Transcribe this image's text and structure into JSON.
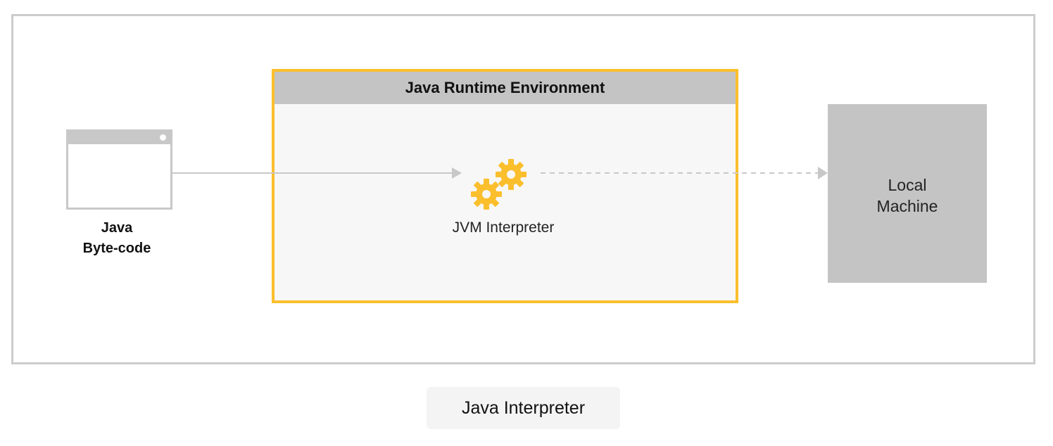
{
  "diagram": {
    "bytecode_label_line1": "Java",
    "bytecode_label_line2": "Byte-code",
    "jre_title": "Java Runtime Environment",
    "jvm_label": "JVM Interpreter",
    "local_label_line1": "Local",
    "local_label_line2": "Machine"
  },
  "caption": "Java Interpreter",
  "colors": {
    "accent": "#fbbf2d",
    "gray_box": "#c4c4c4",
    "arrow": "#c8c8c8"
  },
  "icons": [
    "window-icon",
    "gears-icon",
    "arrow-icon"
  ]
}
